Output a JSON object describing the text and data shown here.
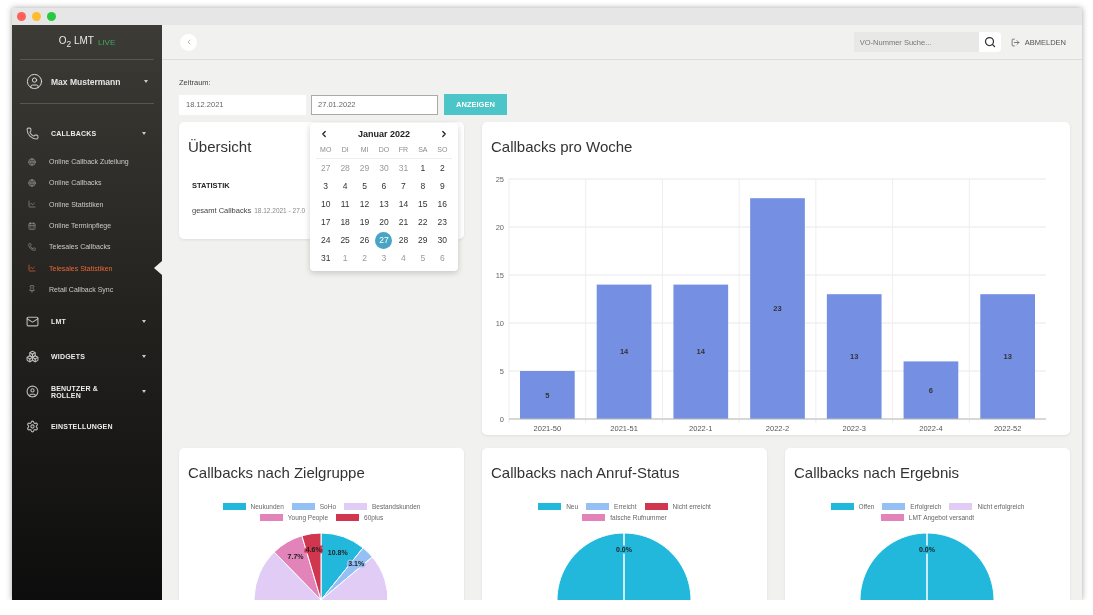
{
  "window": {
    "controls": [
      {
        "color": "#fe5f57"
      },
      {
        "color": "#febc2e"
      },
      {
        "color": "#28c840"
      }
    ]
  },
  "sidebar": {
    "logo": "O$_{2}$ LMT",
    "logo_badge": "LIVE",
    "user": {
      "name": "Max Mustermann"
    },
    "sections": [
      {
        "label": "CALLBACKS",
        "kind": "menu",
        "children": [
          {
            "label": "Online Callback Zuteilung",
            "selected": false
          },
          {
            "label": "Online Callbacks",
            "selected": false
          },
          {
            "label": "Online Statistiken",
            "selected": false
          },
          {
            "label": "Online Terminpflege",
            "selected": false
          },
          {
            "label": "Telesales Callbacks",
            "selected": false
          },
          {
            "label": "Telesales Statistiken",
            "selected": true
          },
          {
            "label": "Retail Callback Sync",
            "selected": false
          }
        ]
      },
      {
        "label": "LMT",
        "kind": "menu"
      },
      {
        "label": "WIDGETS",
        "kind": "menu"
      },
      {
        "label": "BENUTZER & ROLLEN",
        "kind": "menu"
      },
      {
        "label": "EINSTELLUNGEN",
        "kind": "link"
      }
    ]
  },
  "topbar": {
    "search": {
      "placeholder": "VO-Nummer Suche..."
    },
    "logout": "ABMELDEN"
  },
  "filter": {
    "label": "Zeitraum:",
    "from": "18.12.2021",
    "to": "27.01.2022",
    "button": "ANZEIGEN"
  },
  "datepicker": {
    "month": "Januar 2022",
    "weekdays": [
      "MO",
      "DI",
      "MI",
      "DO",
      "FR",
      "SA",
      "SO"
    ],
    "days": [
      {
        "label": "27",
        "kind": "outside",
        "selected": false
      },
      {
        "label": "28",
        "kind": "outside",
        "selected": false
      },
      {
        "label": "29",
        "kind": "outside",
        "selected": false
      },
      {
        "label": "30",
        "kind": "outside",
        "selected": false
      },
      {
        "label": "31",
        "kind": "outside",
        "selected": false
      },
      {
        "label": "1",
        "kind": "current",
        "selected": false
      },
      {
        "label": "2",
        "kind": "current",
        "selected": false
      },
      {
        "label": "3",
        "kind": "current",
        "selected": false
      },
      {
        "label": "4",
        "kind": "current",
        "selected": false
      },
      {
        "label": "5",
        "kind": "current",
        "selected": false
      },
      {
        "label": "6",
        "kind": "current",
        "selected": false
      },
      {
        "label": "7",
        "kind": "current",
        "selected": false
      },
      {
        "label": "8",
        "kind": "current",
        "selected": false
      },
      {
        "label": "9",
        "kind": "current",
        "selected": false
      },
      {
        "label": "10",
        "kind": "current",
        "selected": false
      },
      {
        "label": "11",
        "kind": "current",
        "selected": false
      },
      {
        "label": "12",
        "kind": "current",
        "selected": false
      },
      {
        "label": "13",
        "kind": "current",
        "selected": false
      },
      {
        "label": "14",
        "kind": "current",
        "selected": false
      },
      {
        "label": "15",
        "kind": "current",
        "selected": false
      },
      {
        "label": "16",
        "kind": "current",
        "selected": false
      },
      {
        "label": "17",
        "kind": "current",
        "selected": false
      },
      {
        "label": "18",
        "kind": "current",
        "selected": false
      },
      {
        "label": "19",
        "kind": "current",
        "selected": false
      },
      {
        "label": "20",
        "kind": "current",
        "selected": false
      },
      {
        "label": "21",
        "kind": "current",
        "selected": false
      },
      {
        "label": "22",
        "kind": "current",
        "selected": false
      },
      {
        "label": "23",
        "kind": "current",
        "selected": false
      },
      {
        "label": "24",
        "kind": "current",
        "selected": false
      },
      {
        "label": "25",
        "kind": "current",
        "selected": false
      },
      {
        "label": "26",
        "kind": "current",
        "selected": false
      },
      {
        "label": "27",
        "kind": "current",
        "selected": true
      },
      {
        "label": "28",
        "kind": "current",
        "selected": false
      },
      {
        "label": "29",
        "kind": "current",
        "selected": false
      },
      {
        "label": "30",
        "kind": "current",
        "selected": false
      },
      {
        "label": "31",
        "kind": "current",
        "selected": false
      },
      {
        "label": "1",
        "kind": "outside",
        "selected": false
      },
      {
        "label": "2",
        "kind": "outside",
        "selected": false
      },
      {
        "label": "3",
        "kind": "outside",
        "selected": false
      },
      {
        "label": "4",
        "kind": "outside",
        "selected": false
      },
      {
        "label": "5",
        "kind": "outside",
        "selected": false
      },
      {
        "label": "6",
        "kind": "outside",
        "selected": false
      }
    ]
  },
  "overview": {
    "title": "Übersicht",
    "heading": "STATISTIK",
    "rows": [
      {
        "label": "gesamt Callbacks",
        "detail": "18.12.2021 - 27.0"
      }
    ]
  },
  "week_chart": {
    "title": "Callbacks pro Woche",
    "chart_data": {
      "type": "bar",
      "categories": [
        "2021-50",
        "2021-51",
        "2022-1",
        "2022-2",
        "2022-3",
        "2022-4",
        "2022-52"
      ],
      "values": [
        5,
        14,
        14,
        23,
        13,
        6,
        13
      ],
      "ylim": [
        0,
        25
      ],
      "yticks": [
        0,
        5,
        10,
        15,
        20,
        25
      ],
      "grid": true,
      "data_labels": true
    }
  },
  "pies": [
    {
      "title": "Callbacks nach Zielgruppe",
      "chart_data": {
        "type": "pie",
        "categories": [
          "Neukunden",
          "SoHo",
          "Bestandskunden",
          "Young People",
          "60plus"
        ],
        "colors": [
          "#22b8dc",
          "#94c0f6",
          "#e1ccf6",
          "#e283b9",
          "#d1364f"
        ],
        "values": [
          10.8,
          3.1,
          73.8,
          7.7,
          4.6
        ],
        "value_labels": [
          "10.8%",
          "3.1%",
          null,
          "7.7%",
          "4.6%"
        ]
      }
    },
    {
      "title": "Callbacks nach Anruf-Status",
      "chart_data": {
        "type": "pie",
        "categories": [
          "Neu",
          "Erreicht",
          "Nicht erreicht",
          "falsche Rufnummer"
        ],
        "colors": [
          "#22b8dc",
          "#94c0f6",
          "#d1364f",
          "#e283b9"
        ],
        "values": [
          100,
          0,
          0,
          0
        ],
        "value_labels": [
          null,
          "0.0%",
          null,
          null
        ]
      }
    },
    {
      "title": "Callbacks nach Ergebnis",
      "chart_data": {
        "type": "pie",
        "categories": [
          "Offen",
          "Erfolgreich",
          "Nicht erfolgreich",
          "LMT Angebot versandt"
        ],
        "colors": [
          "#22b8dc",
          "#94c0f6",
          "#e1ccf6",
          "#e283b9"
        ],
        "values": [
          100,
          0,
          0,
          0
        ],
        "value_labels": [
          null,
          "0.0%",
          null,
          null
        ]
      }
    }
  ]
}
